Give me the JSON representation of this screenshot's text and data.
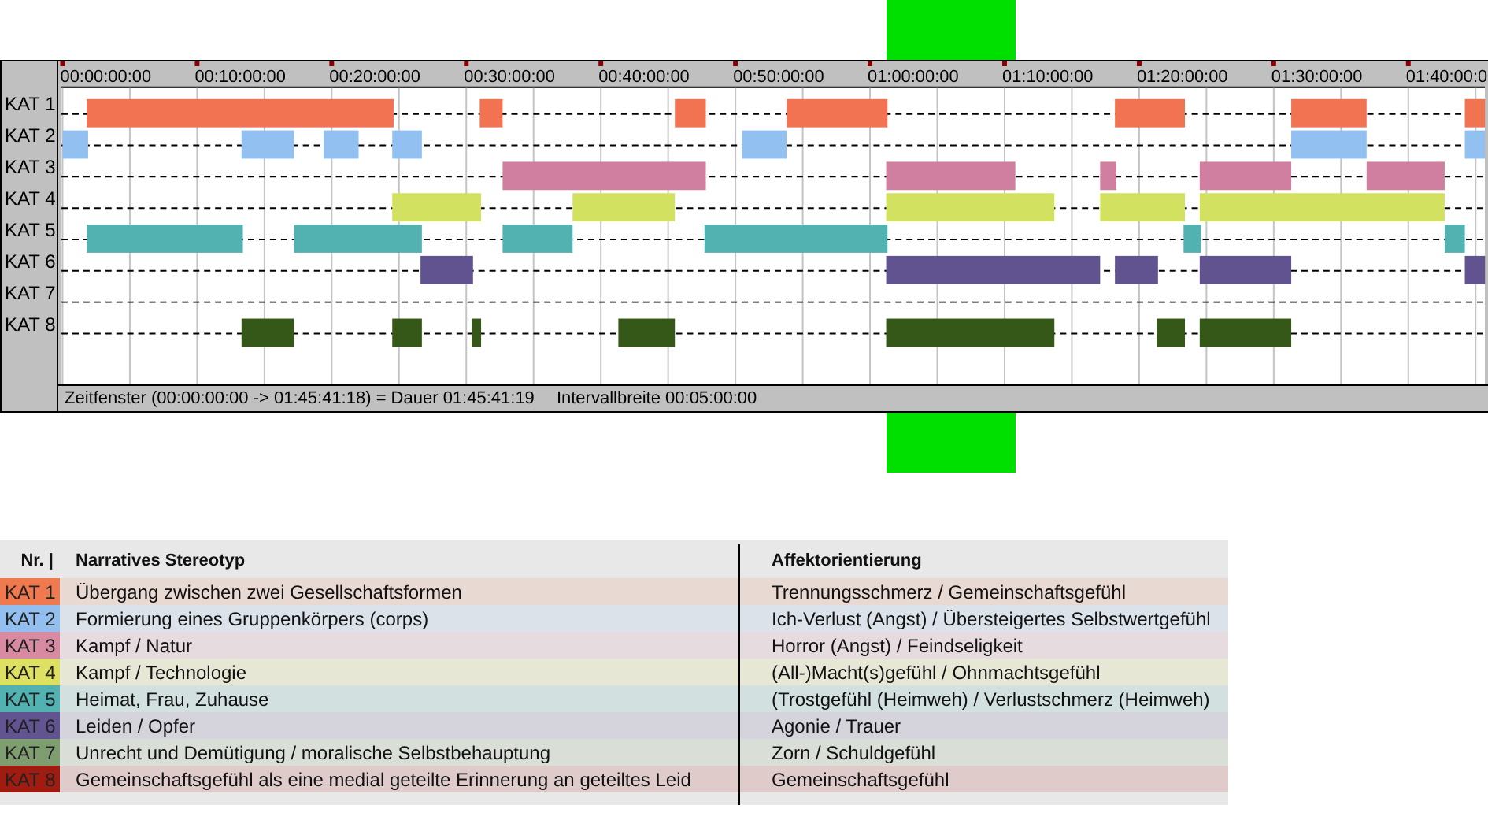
{
  "timeline": {
    "ticks": [
      "00:00:00:00",
      "00:10:00:00",
      "00:20:00:00",
      "00:30:00:00",
      "00:40:00:00",
      "00:50:00:00",
      "01:00:00:00",
      "01:10:00:00",
      "01:20:00:00",
      "01:30:00:00",
      "01:40:00:0"
    ],
    "tracks": [
      {
        "label": "KAT 1",
        "color": "#f27352"
      },
      {
        "label": "KAT 2",
        "color": "#92c0f0"
      },
      {
        "label": "KAT 3",
        "color": "#d17fa0"
      },
      {
        "label": "KAT 4",
        "color": "#d3e160"
      },
      {
        "label": "KAT 5",
        "color": "#52b1b1"
      },
      {
        "label": "KAT 6",
        "color": "#615290"
      },
      {
        "label": "KAT 7"
      },
      {
        "label": "KAT 8",
        "color": "#355717"
      }
    ],
    "status": "Zeitfenster (00:00:00:00 -> 01:45:41:18) = Dauer 01:45:41:19",
    "interval": "Intervallbreite 00:05:00:00"
  },
  "legend": {
    "columns": [
      "Nr. |",
      "Narratives Stereotyp",
      "Affektorientierung"
    ],
    "rows": [
      {
        "nr": "KAT 1",
        "color": "#f07a50",
        "stereotyp": "Übergang zwischen zwei Gesellschaftsformen",
        "affekt": "Trennungsschmerz / Gemeinschaftsgefühl"
      },
      {
        "nr": "KAT 2",
        "color": "#93bff0",
        "stereotyp": "Formierung eines Gruppenkörpers (corps)",
        "affekt": "Ich-Verlust (Angst) / Übersteigertes Selbstwertgefühl"
      },
      {
        "nr": "KAT 3",
        "color": "#d98aa3",
        "stereotyp": "Kampf / Natur",
        "affekt": "Horror (Angst) / Feindseligkeit"
      },
      {
        "nr": "KAT 4",
        "color": "#dde060",
        "stereotyp": "Kampf / Technologie",
        "affekt": "(All-)Macht(s)gefühl / Ohnmachtsgefühl"
      },
      {
        "nr": "KAT 5",
        "color": "#52b1b1",
        "stereotyp": "Heimat, Frau, Zuhause",
        "affekt": "(Trostgefühl (Heimweh) / Verlustschmerz (Heimweh)"
      },
      {
        "nr": "KAT 6",
        "color": "#625490",
        "stereotyp": "Leiden / Opfer",
        "affekt": "Agonie / Trauer"
      },
      {
        "nr": "KAT 7",
        "color": "#7f9e70",
        "stereotyp": "Unrecht und Demütigung / moralische Selbstbehauptung",
        "affekt": "Zorn / Schuldgefühl"
      },
      {
        "nr": "KAT 8",
        "color": "#a01c10",
        "stereotyp": "Gemeinschaftsgefühl als eine medial geteilte Erinnerung an geteiltes Leid",
        "affekt": "Gemeinschaftsgefühl"
      }
    ]
  }
}
